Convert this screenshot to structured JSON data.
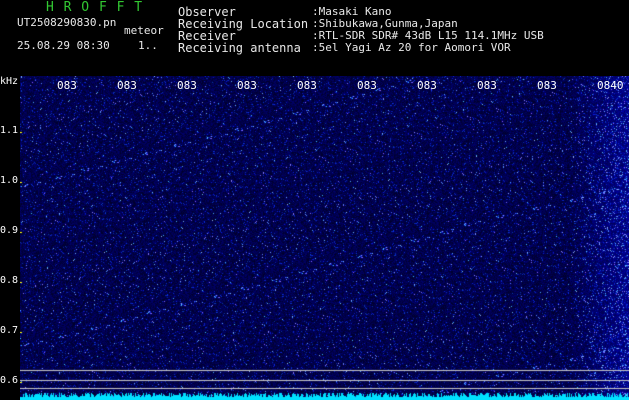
{
  "header": {
    "brand": "H R O F F T",
    "filename": "UT2508290830.pn",
    "mode_label": "meteor",
    "datetime": "25.08.29 08:30",
    "counter": "1..",
    "info": [
      {
        "label": "Observer",
        "value": ":Masaki Kano"
      },
      {
        "label": "Receiving Location",
        "value": ":Shibukawa,Gunma,Japan"
      },
      {
        "label": "Receiver",
        "value": ":RTL-SDR SDR# 43dB L15 114.1MHz USB"
      },
      {
        "label": "Receiving antenna",
        "value": ":5el Yagi Az 20 for Aomori VOR"
      }
    ]
  },
  "yaxis": {
    "unit": "kHz",
    "ticks": [
      "1.1",
      "1.0",
      "0.9",
      "0.8",
      "0.7",
      "0.6"
    ]
  },
  "xaxis": {
    "ticks": [
      "083",
      "083",
      "083",
      "083",
      "083",
      "083",
      "083",
      "083",
      "083",
      "0840"
    ]
  },
  "colors": {
    "background": "#000000",
    "spectrum_base": "#0a0a70",
    "noise_bright": "#3c5aff",
    "baseline": "#00e0ff",
    "grid_line": "#c8c8c8",
    "tick_marker": "#ffff00",
    "brand": "#32c832",
    "text": "#e8e8e8"
  }
}
